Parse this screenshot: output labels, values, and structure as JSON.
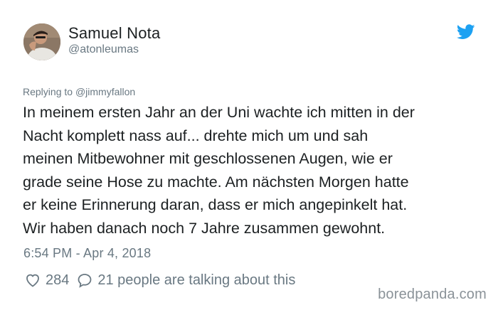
{
  "tweet": {
    "author_name": "Samuel Nota",
    "author_handle": "@atonleumas",
    "replying_prefix": "Replying to ",
    "replying_to": "@jimmyfallon",
    "text": "In meinem ersten Jahr an der Uni wachte ich mitten in der\nNacht komplett nass auf... drehte mich um und sah\nmeinen Mitbewohner mit geschlossenen Augen, wie er\ngrade seine Hose zu machte. Am nächsten Morgen hatte\ner keine Erinnerung daran, dass er mich angepinkelt hat.\nWir haben danach noch 7 Jahre zusammen gewohnt.",
    "timestamp": "6:54 PM - Apr 4, 2018",
    "likes": "284",
    "talking": "21 people are talking about this"
  },
  "icons": {
    "brand": "twitter-bird-icon",
    "like": "heart-icon",
    "reply": "speech-bubble-icon"
  },
  "watermark": "boredpanda.com",
  "colors": {
    "twitter_blue": "#1da1f2",
    "text": "#1c2022",
    "muted": "#697882"
  }
}
